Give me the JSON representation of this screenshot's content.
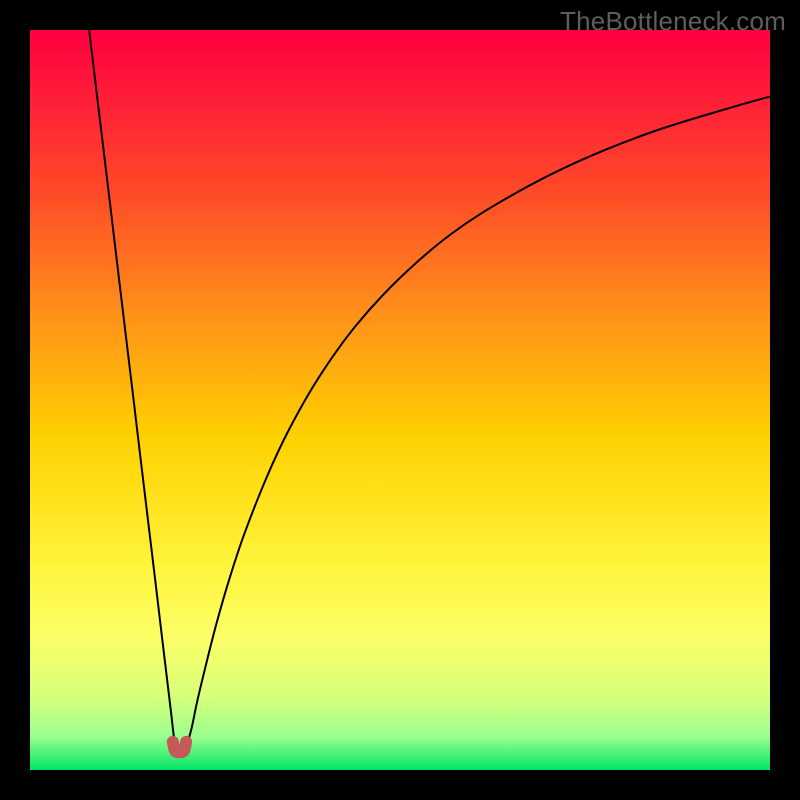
{
  "watermark": "TheBottleneck.com",
  "chart_data": {
    "type": "line",
    "title": "",
    "xlabel": "",
    "ylabel": "",
    "x_range": [
      0,
      100
    ],
    "y_range": [
      0,
      100
    ],
    "gradient_stops": [
      {
        "offset": 0.0,
        "color": "#ff0040"
      },
      {
        "offset": 0.08,
        "color": "#ff1a3a"
      },
      {
        "offset": 0.22,
        "color": "#ff4a28"
      },
      {
        "offset": 0.38,
        "color": "#ff8f1a"
      },
      {
        "offset": 0.55,
        "color": "#ffd100"
      },
      {
        "offset": 0.72,
        "color": "#fff43a"
      },
      {
        "offset": 0.82,
        "color": "#fcff66"
      },
      {
        "offset": 0.9,
        "color": "#d8ff7a"
      },
      {
        "offset": 0.955,
        "color": "#9aff8e"
      },
      {
        "offset": 1.0,
        "color": "#00e564"
      }
    ],
    "series": [
      {
        "name": "bottleneck-curve",
        "color": "#000000",
        "width": 2.0,
        "x": [
          8.0,
          9.0,
          10.0,
          11.0,
          12.0,
          13.0,
          14.0,
          15.0,
          16.0,
          17.0,
          18.0,
          19.0,
          19.6,
          20.2,
          21.0,
          21.8,
          22.6,
          23.8,
          25.2,
          27.0,
          29.0,
          32.0,
          35.0,
          39.0,
          44.0,
          50.0,
          57.0,
          65.0,
          74.0,
          84.0,
          95.0,
          100.0
        ],
        "y": [
          100.0,
          91.6,
          83.3,
          75.0,
          66.6,
          58.3,
          50.0,
          41.6,
          33.3,
          25.0,
          16.6,
          8.3,
          3.5,
          2.5,
          3.0,
          5.5,
          9.3,
          14.3,
          19.8,
          26.0,
          32.0,
          39.6,
          46.0,
          53.0,
          60.0,
          66.5,
          72.5,
          77.6,
          82.2,
          86.2,
          89.6,
          91.0
        ]
      },
      {
        "name": "selection-marker",
        "color": "#c35a57",
        "width": 12,
        "cap": "round",
        "x": [
          19.3,
          19.6,
          20.2,
          20.8,
          21.1
        ],
        "y": [
          3.8,
          2.6,
          2.4,
          2.6,
          3.8
        ]
      }
    ],
    "annotations": []
  }
}
